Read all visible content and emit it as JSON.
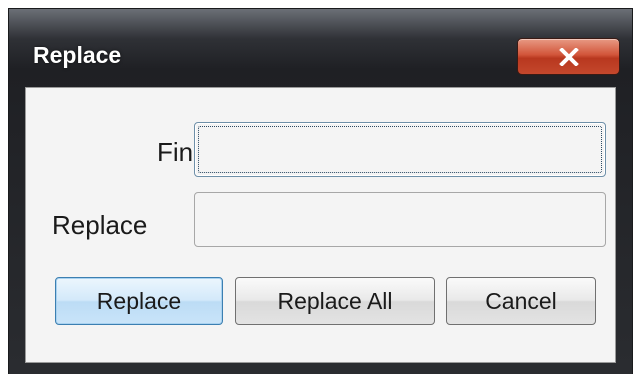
{
  "dialog": {
    "title": "Replace",
    "close_label": "X"
  },
  "find": {
    "label": "Find:",
    "value": ""
  },
  "replace": {
    "label": "Replace",
    "value": ""
  },
  "buttons": {
    "replace": "Replace",
    "replace_all": "Replace All",
    "cancel": "Cancel"
  },
  "colors": {
    "title_bar": "#2f3136",
    "close_button": "#c4472c",
    "default_button": "#bcdcf5"
  }
}
